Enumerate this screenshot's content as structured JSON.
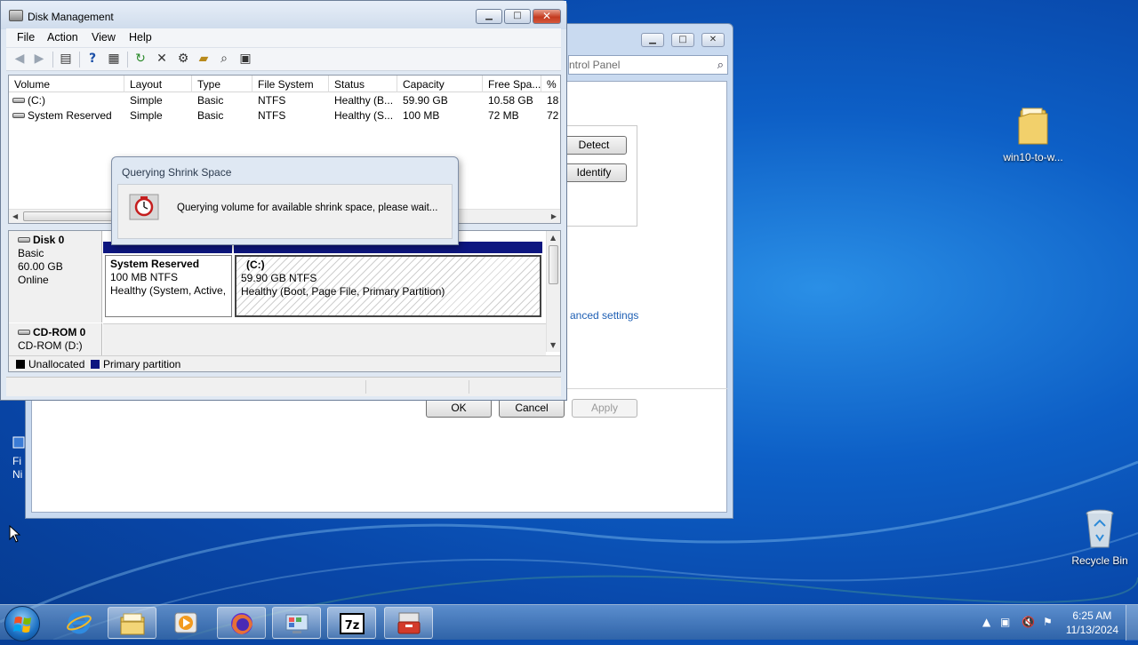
{
  "desktop": {
    "folder_label": "win10-to-w...",
    "recycle_label": "Recycle Bin",
    "side_fragment_1": "Fi",
    "side_fragment_2": "Ni"
  },
  "control_panel": {
    "search_text": "ntrol Panel",
    "detect_label": "Detect",
    "identify_label": "Identify",
    "advanced_link": "anced settings",
    "ok_label": "OK",
    "cancel_label": "Cancel",
    "apply_label": "Apply"
  },
  "disk_management": {
    "title": "Disk Management",
    "menu": [
      "File",
      "Action",
      "View",
      "Help"
    ],
    "columns": [
      "Volume",
      "Layout",
      "Type",
      "File System",
      "Status",
      "Capacity",
      "Free Spa...",
      "% F"
    ],
    "rows": [
      [
        "(C:)",
        "Simple",
        "Basic",
        "NTFS",
        "Healthy (B...",
        "59.90 GB",
        "10.58 GB",
        "18"
      ],
      [
        "System Reserved",
        "Simple",
        "Basic",
        "NTFS",
        "Healthy (S...",
        "100 MB",
        "72 MB",
        "72"
      ]
    ],
    "disk0": {
      "name": "Disk 0",
      "type": "Basic",
      "size": "60.00 GB",
      "state": "Online",
      "partitions": [
        {
          "name": "System Reserved",
          "size": "100 MB NTFS",
          "status": "Healthy (System, Active,"
        },
        {
          "name": "(C:)",
          "size": "59.90 GB NTFS",
          "status": "Healthy (Boot, Page File, Primary Partition)"
        }
      ]
    },
    "cdrom": {
      "name": "CD-ROM 0",
      "drive": "CD-ROM (D:)"
    },
    "legend": {
      "unallocated": "Unallocated",
      "primary": "Primary partition"
    },
    "colors": {
      "unallocated": "#000000",
      "primary": "#0d1680"
    }
  },
  "dialog": {
    "title": "Querying Shrink Space",
    "message": "Querying volume for available shrink space, please wait..."
  },
  "taskbar": {
    "time": "6:25 AM",
    "date": "11/13/2024",
    "apps": [
      "internet-explorer",
      "file-explorer",
      "media-player",
      "firefox",
      "control-panel",
      "7-zip",
      "disk-management"
    ]
  }
}
